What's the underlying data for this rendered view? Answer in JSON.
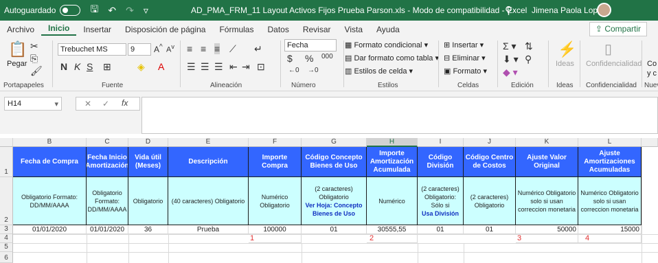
{
  "titlebar": {
    "autosave_label": "Autoguardado",
    "document_title": "AD_PMA_FRM_11 Layout Activos Fijos Prueba Parson.xls  -  Modo de compatibilidad  -  Excel",
    "user_name": "Jimena Paola Lopez"
  },
  "tabs": [
    "Archivo",
    "Inicio",
    "Insertar",
    "Disposición de página",
    "Fórmulas",
    "Datos",
    "Revisar",
    "Vista",
    "Ayuda"
  ],
  "share_label": "Compartir",
  "ribbon": {
    "clipboard": {
      "paste": "Pegar",
      "group": "Portapapeles"
    },
    "font": {
      "name": "Trebuchet MS",
      "size": "9",
      "group": "Fuente"
    },
    "alignment": {
      "group": "Alineación"
    },
    "number": {
      "format": "Fecha",
      "group": "Número"
    },
    "styles": {
      "conditional": "Formato condicional",
      "as_table": "Dar formato como tabla",
      "cell_styles": "Estilos de celda",
      "group": "Estilos"
    },
    "cells": {
      "insert": "Insertar",
      "delete": "Eliminar",
      "format": "Formato",
      "group": "Celdas"
    },
    "editing": {
      "group": "Edición"
    },
    "ideas": {
      "label": "Ideas",
      "group": "Ideas"
    },
    "confidentiality": {
      "label": "Confidencialidad",
      "group": "Confidencialidad"
    },
    "new_group": {
      "label1": "Co",
      "label2": "y c",
      "group": "Nuev"
    }
  },
  "formula_bar": {
    "cell_ref": "H14",
    "fx": "fx",
    "content": ""
  },
  "sheet": {
    "columns": [
      "B",
      "C",
      "D",
      "E",
      "F",
      "G",
      "H",
      "I",
      "J",
      "K",
      "L"
    ],
    "selected_column": "H",
    "rows": [
      "1",
      "2",
      "3",
      "4",
      "5",
      "6"
    ],
    "headers": [
      "Fecha de Compra",
      "Fecha Inicio Amortización",
      "Vida útil (Meses)",
      "Descripción",
      "Importe Compra",
      "Código Concepto Bienes de Uso",
      "Importe Amortización Acumulada",
      "Código División",
      "Código Centro de Costos",
      "Ajuste Valor Original",
      "Ajuste Amortizaciones Acumuladas"
    ],
    "descriptions": [
      "Obligatorio Formato: DD/MM/AAAA",
      "Obligatorio Formato: DD/MM/AAAA",
      "Obligatorio",
      "(40 caracteres) Obligatorio",
      "Numérico Obligatorio",
      "(2 caracteres) Obligatorio",
      "Numérico",
      "(2 caracteres) Obligatorio: Sólo si",
      "(2 caracteres) Obligatorio",
      "Numérico Obligatorio solo si usan correccion monetaria",
      "Numérico Obligatorio solo si usan correccion monetaria"
    ],
    "desc_link_g": "Ver Hoja: Concepto Bienes de Uso",
    "desc_link_i": "Usa División",
    "row3": [
      "01/01/2020",
      "01/01/2020",
      "36",
      "Prueba",
      "100000",
      "01",
      "30555,55",
      "01",
      "01",
      "50000",
      "15000"
    ],
    "row4_markers": [
      "1",
      "2",
      "3",
      "4"
    ]
  }
}
